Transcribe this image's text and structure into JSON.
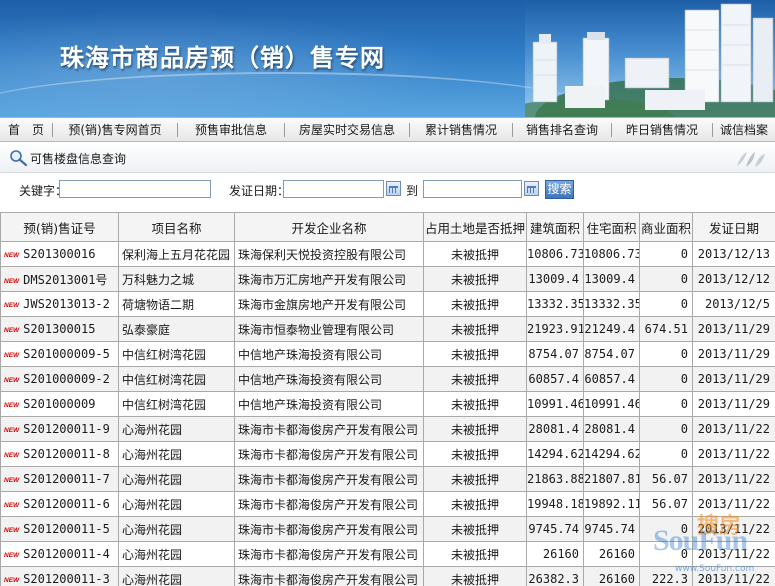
{
  "banner": {
    "title": "珠海市商品房预（销）售专网"
  },
  "nav": {
    "items": [
      "首　页",
      "预(销)售专网首页",
      "预售审批信息",
      "房屋实时交易信息",
      "累计销售情况",
      "销售排名查询",
      "昨日销售情况",
      "诚信档案"
    ]
  },
  "query": {
    "title": "可售楼盘信息查询",
    "keyword_label": "关键字：",
    "date_label": "发证日期：",
    "to_label": "到",
    "search_label": "搜索",
    "keyword_value": "",
    "date_from_value": "",
    "date_to_value": ""
  },
  "table": {
    "new_badge": "NEW",
    "headers": [
      "预(销)售证号",
      "项目名称",
      "开发企业名称",
      "占用土地是否抵押",
      "建筑面积",
      "住宅面积",
      "商业面积",
      "发证日期"
    ],
    "rows": [
      {
        "id": "S201300016",
        "project": "保利海上五月花花园",
        "developer": "珠海保利天悦投资控股有限公司",
        "mortgage": "未被抵押",
        "building_area": "10806.73",
        "residential_area": "10806.73",
        "commercial_area": "0",
        "date": "2013/12/13"
      },
      {
        "id": "DMS2013001号",
        "project": "万科魅力之城",
        "developer": "珠海市万汇房地产开发有限公司",
        "mortgage": "未被抵押",
        "building_area": "13009.4",
        "residential_area": "13009.4",
        "commercial_area": "0",
        "date": "2013/12/12"
      },
      {
        "id": "JWS2013013-2",
        "project": "荷塘物语二期",
        "developer": "珠海市金旗房地产开发有限公司",
        "mortgage": "未被抵押",
        "building_area": "13332.35",
        "residential_area": "13332.35",
        "commercial_area": "0",
        "date": "2013/12/5"
      },
      {
        "id": "S201300015",
        "project": "弘泰豪庭",
        "developer": "珠海市恒泰物业管理有限公司",
        "mortgage": "未被抵押",
        "building_area": "21923.91",
        "residential_area": "21249.4",
        "commercial_area": "674.51",
        "date": "2013/11/29"
      },
      {
        "id": "S201000009-5",
        "project": "中信红树湾花园",
        "developer": "中信地产珠海投资有限公司",
        "mortgage": "未被抵押",
        "building_area": "8754.07",
        "residential_area": "8754.07",
        "commercial_area": "0",
        "date": "2013/11/29"
      },
      {
        "id": "S201000009-2",
        "project": "中信红树湾花园",
        "developer": "中信地产珠海投资有限公司",
        "mortgage": "未被抵押",
        "building_area": "60857.4",
        "residential_area": "60857.4",
        "commercial_area": "0",
        "date": "2013/11/29"
      },
      {
        "id": "S201000009",
        "project": "中信红树湾花园",
        "developer": "中信地产珠海投资有限公司",
        "mortgage": "未被抵押",
        "building_area": "10991.46",
        "residential_area": "10991.46",
        "commercial_area": "0",
        "date": "2013/11/29"
      },
      {
        "id": "S201200011-9",
        "project": "心海州花园",
        "developer": "珠海市卡都海俊房产开发有限公司",
        "mortgage": "未被抵押",
        "building_area": "28081.4",
        "residential_area": "28081.4",
        "commercial_area": "0",
        "date": "2013/11/22"
      },
      {
        "id": "S201200011-8",
        "project": "心海州花园",
        "developer": "珠海市卡都海俊房产开发有限公司",
        "mortgage": "未被抵押",
        "building_area": "14294.62",
        "residential_area": "14294.62",
        "commercial_area": "0",
        "date": "2013/11/22"
      },
      {
        "id": "S201200011-7",
        "project": "心海州花园",
        "developer": "珠海市卡都海俊房产开发有限公司",
        "mortgage": "未被抵押",
        "building_area": "21863.88",
        "residential_area": "21807.81",
        "commercial_area": "56.07",
        "date": "2013/11/22"
      },
      {
        "id": "S201200011-6",
        "project": "心海州花园",
        "developer": "珠海市卡都海俊房产开发有限公司",
        "mortgage": "未被抵押",
        "building_area": "19948.18",
        "residential_area": "19892.11",
        "commercial_area": "56.07",
        "date": "2013/11/22"
      },
      {
        "id": "S201200011-5",
        "project": "心海州花园",
        "developer": "珠海市卡都海俊房产开发有限公司",
        "mortgage": "未被抵押",
        "building_area": "9745.74",
        "residential_area": "9745.74",
        "commercial_area": "0",
        "date": "2013/11/22"
      },
      {
        "id": "S201200011-4",
        "project": "心海州花园",
        "developer": "珠海市卡都海俊房产开发有限公司",
        "mortgage": "未被抵押",
        "building_area": "26160",
        "residential_area": "26160",
        "commercial_area": "0",
        "date": "2013/11/22"
      },
      {
        "id": "S201200011-3",
        "project": "心海州花园",
        "developer": "珠海市卡都海俊房产开发有限公司",
        "mortgage": "未被抵押",
        "building_area": "26382.3",
        "residential_area": "26160",
        "commercial_area": "222.3",
        "date": "2013/11/22"
      }
    ]
  },
  "watermark": {
    "brand": "SouFun",
    "cn": "搜房",
    "url": "www.SouFun.com"
  },
  "colors": {
    "banner_blue": "#2f7cc6",
    "new_badge_red": "#d40000",
    "button_blue": "#3d74bd"
  }
}
